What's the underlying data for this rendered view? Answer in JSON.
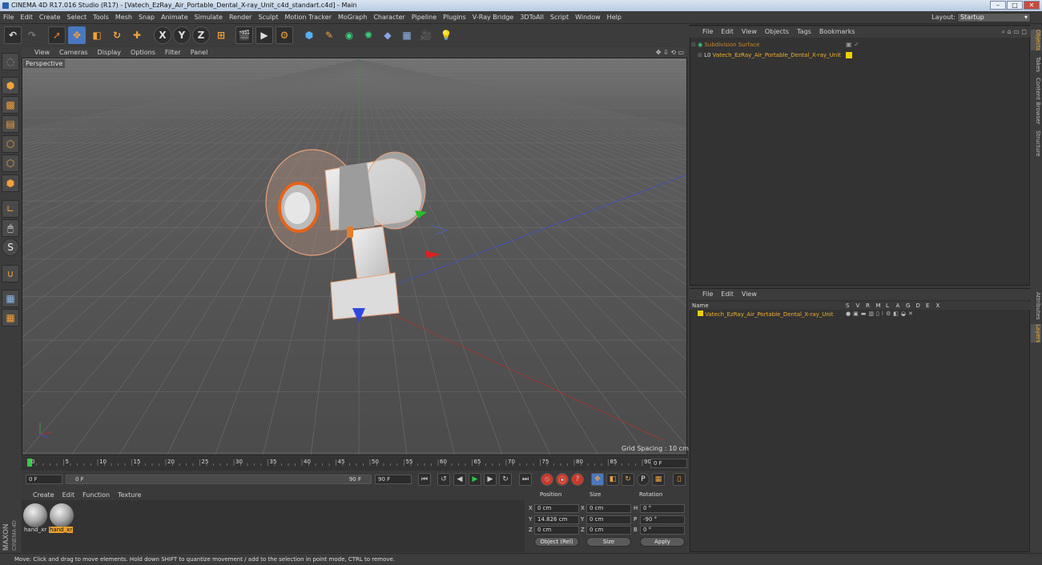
{
  "window": {
    "title": "CINEMA 4D R17.016 Studio (R17) - [Vatech_EzRay_Air_Portable_Dental_X-ray_Unit_c4d_standart.c4d] - Main",
    "controls": [
      "–",
      "□",
      "✕"
    ]
  },
  "menubar": {
    "items": [
      "File",
      "Edit",
      "Create",
      "Select",
      "Tools",
      "Mesh",
      "Snap",
      "Animate",
      "Simulate",
      "Render",
      "Sculpt",
      "Motion Tracker",
      "MoGraph",
      "Character",
      "Pipeline",
      "Plugins",
      "V-Ray Bridge",
      "3DToAll",
      "Script",
      "Window",
      "Help"
    ],
    "layout_label": "Layout:",
    "layout_value": "Startup"
  },
  "toolbar": {
    "icons": [
      "undo-icon",
      "redo-icon",
      "live-selection-icon",
      "move-icon",
      "scale-icon",
      "rotate-icon",
      "add-object-icon",
      "x-axis-icon",
      "y-axis-icon",
      "z-axis-icon",
      "world-coord-icon",
      "render-view-icon",
      "render-picture-viewer-icon",
      "edit-render-settings-icon",
      "cube-icon",
      "pen-icon",
      "subdivision-icon",
      "array-icon",
      "deformer-icon",
      "floor-icon",
      "camera-icon",
      "light-icon"
    ],
    "axis_labels": [
      "X",
      "Y",
      "Z"
    ]
  },
  "viewport": {
    "menu": [
      "View",
      "Cameras",
      "Display",
      "Options",
      "Filter",
      "Panel"
    ],
    "camera_label": "Perspective",
    "grid_spacing": "Grid Spacing : 10 cm"
  },
  "timeline": {
    "ticks": [
      "0",
      "5",
      "10",
      "15",
      "20",
      "25",
      "30",
      "35",
      "40",
      "45",
      "50",
      "55",
      "60",
      "65",
      "70",
      "75",
      "80",
      "85",
      "90"
    ],
    "current_frame": "0 F",
    "start_field": "0 F",
    "range_start": "0 F",
    "range_end": "90 F",
    "end_field": "90 F"
  },
  "materials": {
    "menu": [
      "Create",
      "Edit",
      "Function",
      "Texture"
    ],
    "items": [
      "hand_xr",
      "hand_xr"
    ]
  },
  "coordinates": {
    "headers": [
      "Position",
      "Size",
      "Rotation"
    ],
    "rows": [
      {
        "axis": "X",
        "pos": "0 cm",
        "saxis": "X",
        "size": "0 cm",
        "raxis": "H",
        "rot": "0 °"
      },
      {
        "axis": "Y",
        "pos": "14.826 cm",
        "saxis": "Y",
        "size": "0 cm",
        "raxis": "P",
        "rot": "-90 °"
      },
      {
        "axis": "Z",
        "pos": "0 cm",
        "saxis": "Z",
        "size": "0 cm",
        "raxis": "B",
        "rot": "0 °"
      }
    ],
    "mode_select": "Object (Rel)",
    "size_select": "Size",
    "apply_label": "Apply"
  },
  "object_manager": {
    "menu": [
      "File",
      "Edit",
      "View",
      "Objects",
      "Tags",
      "Bookmarks"
    ],
    "objects": [
      {
        "name": "Subdivision Surface",
        "indent": 0
      },
      {
        "name": "Vatech_EzRay_Air_Portable_Dental_X-ray_Unit",
        "indent": 1
      }
    ]
  },
  "layer_manager": {
    "menu": [
      "File",
      "Edit",
      "View"
    ],
    "column_name": "Name",
    "columns": [
      "S",
      "V",
      "R",
      "M",
      "L",
      "A",
      "G",
      "D",
      "E",
      "X"
    ],
    "layers": [
      "Vatech_EzRay_Air_Portable_Dental_X-ray_Unit"
    ]
  },
  "right_tabs": {
    "top": [
      "Objects",
      "Takes",
      "Content Browser",
      "Structure"
    ],
    "bottom": [
      "Attributes",
      "Layers"
    ]
  },
  "status": "Move: Click and drag to move elements. Hold down SHIFT to quantize movement / add to the selection in point mode, CTRL to remove.",
  "colors": {
    "accent_orange": "#e8a030",
    "accent_blue": "#4a77c0",
    "viewport_bg": "#5e5e5e"
  }
}
